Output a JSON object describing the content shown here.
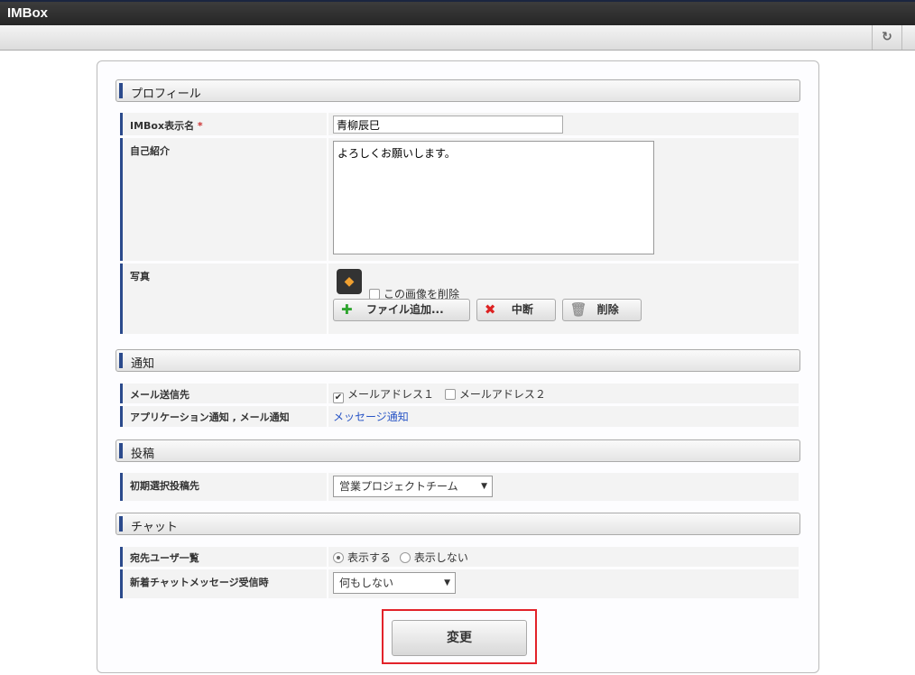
{
  "app": {
    "title": "IMBox",
    "refresh_icon": "refresh-icon"
  },
  "sections": {
    "profile": "プロフィール",
    "notify": "通知",
    "post": "投稿",
    "chat": "チャット"
  },
  "profile": {
    "display_name_label": "IMBox表示名",
    "required_mark": "*",
    "display_name_value": "青柳辰巳",
    "intro_label": "自己紹介",
    "intro_value": "よろしくお願いします。",
    "photo_label": "写真",
    "delete_image_label": "この画像を削除",
    "add_file": "ファイル追加...",
    "cancel": "中断",
    "delete": "削除"
  },
  "notify": {
    "mail_label": "メール送信先",
    "mail1": "メールアドレス１",
    "mail2": "メールアドレス２",
    "mail1_checked": true,
    "mail2_checked": false,
    "app_label": "アプリケーション通知 , メール通知",
    "app_link": "メッセージ通知"
  },
  "post": {
    "default_label": "初期選択投稿先",
    "default_value": "営業プロジェクトチーム"
  },
  "chat": {
    "users_label": "宛先ユーザ一覧",
    "show": "表示する",
    "hide": "表示しない",
    "selected": "show",
    "new_label": "新着チャットメッセージ受信時",
    "new_value": "何もしない"
  },
  "submit": "変更"
}
